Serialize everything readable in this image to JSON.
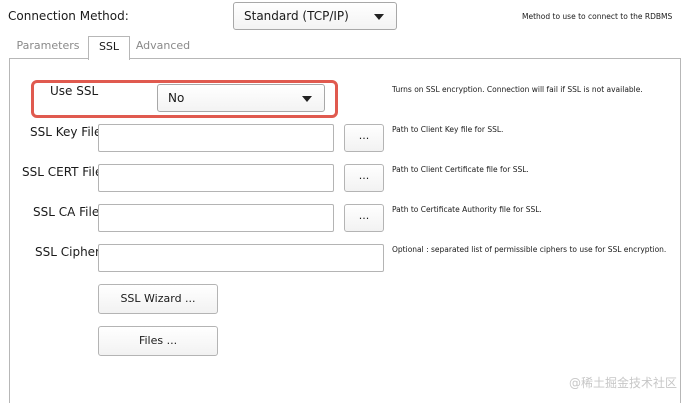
{
  "connection": {
    "label": "Connection Method:",
    "value": "Standard (TCP/IP)",
    "description": "Method to use to connect to the RDBMS"
  },
  "tabs": [
    {
      "label": "Parameters",
      "active": false
    },
    {
      "label": "SSL",
      "active": true
    },
    {
      "label": "Advanced",
      "active": false
    }
  ],
  "ssl": {
    "use_ssl": {
      "label": "Use SSL",
      "value": "No",
      "hint": "Turns on SSL encryption. Connection will fail if SSL is not available."
    },
    "key_file": {
      "label": "SSL Key File:",
      "value": "",
      "browse": "...",
      "hint": "Path to Client Key file for SSL."
    },
    "cert_file": {
      "label": "SSL CERT File:",
      "value": "",
      "browse": "...",
      "hint": "Path to Client Certificate file for SSL."
    },
    "ca_file": {
      "label": "SSL CA File:",
      "value": "",
      "browse": "...",
      "hint": "Path to Certificate Authority file for SSL."
    },
    "cipher": {
      "label": "SSL Cipher:",
      "value": "",
      "hint": "Optional : separated list of permissible ciphers to use for SSL encryption."
    },
    "wizard_button": "SSL Wizard ...",
    "files_button": "Files ..."
  },
  "highlight_color": "#e05a4f",
  "watermark": "@稀土掘金技术社区"
}
